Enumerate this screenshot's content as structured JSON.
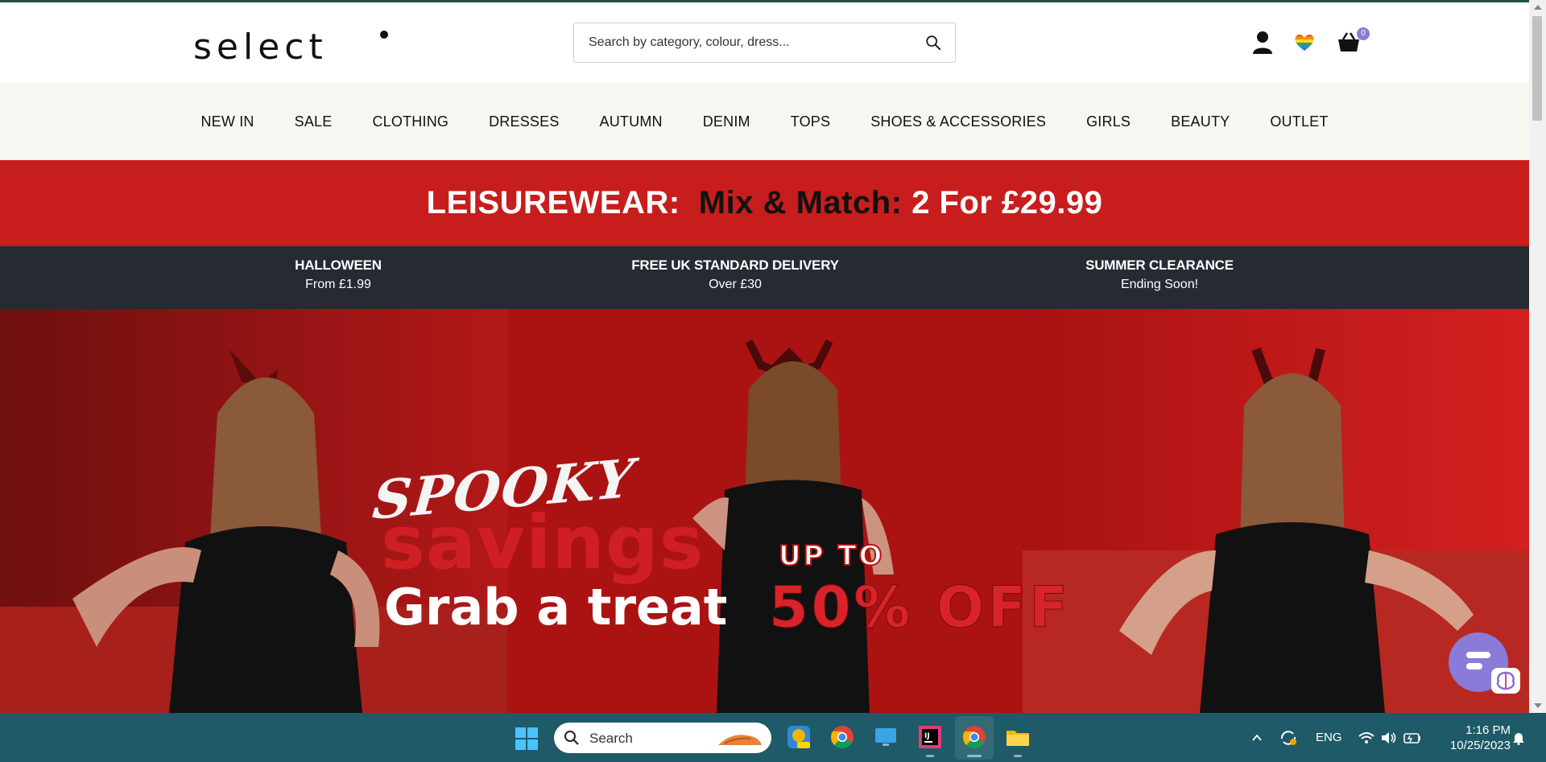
{
  "header": {
    "logo_text": "select",
    "search_placeholder": "Search by category, colour, dress...",
    "cart_count": "0"
  },
  "nav": {
    "items": [
      "NEW IN",
      "SALE",
      "CLOTHING",
      "DRESSES",
      "AUTUMN",
      "DENIM",
      "TOPS",
      "SHOES & ACCESSORIES",
      "GIRLS",
      "BEAUTY",
      "OUTLET"
    ]
  },
  "promo": {
    "label": "LEISUREWEAR:",
    "offer": "Mix & Match:",
    "price": "2 For £29.99"
  },
  "info_bar": [
    {
      "title": "HALLOWEEN",
      "subtitle": "From £1.99"
    },
    {
      "title": "FREE UK STANDARD DELIVERY",
      "subtitle": "Over £30"
    },
    {
      "title": "SUMMER CLEARANCE",
      "subtitle": "Ending Soon!"
    }
  ],
  "hero": {
    "line1": "SPOOKY",
    "line2": "savings",
    "line3": "Grab a treat",
    "line4": "UP TO",
    "line5": "50% OFF"
  },
  "taskbar": {
    "search_label": "Search",
    "language": "ENG",
    "time": "1:16 PM",
    "date": "10/25/2023"
  },
  "colors": {
    "promo_red": "#c81d1d",
    "info_dark": "#262a33",
    "nav_bg": "#f8f6f0",
    "accent_purple": "#8a7bd8",
    "taskbar": "#1e5a67"
  }
}
